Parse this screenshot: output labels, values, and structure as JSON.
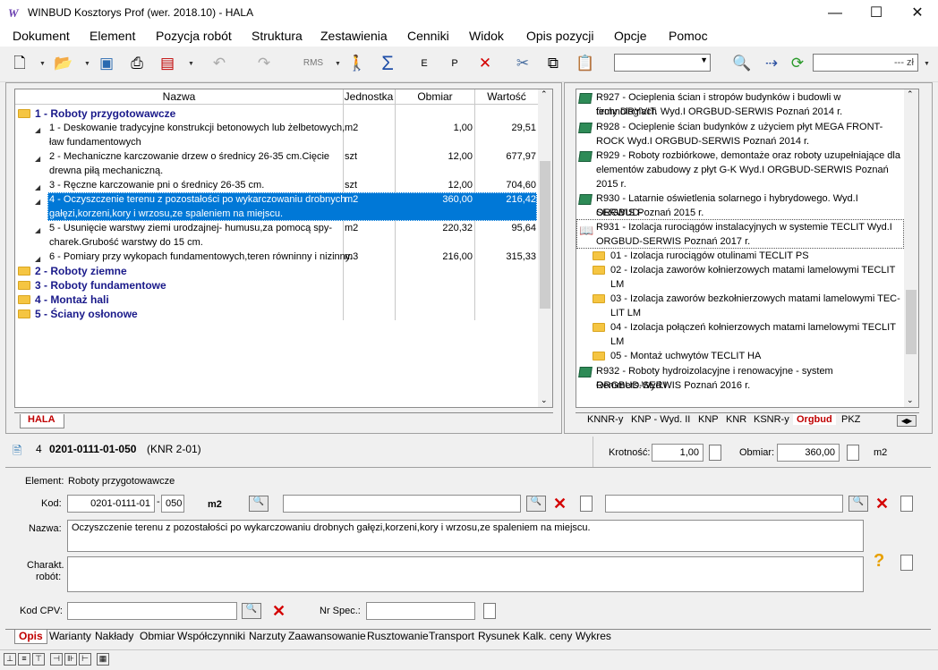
{
  "window": {
    "title": "WINBUD Kosztorys Prof (wer. 2018.10) - HALA",
    "minimize": "—",
    "maximize": "☐",
    "close": "✕"
  },
  "menu": [
    "Dokument",
    "Element",
    "Pozycja robót",
    "Struktura",
    "Zestawienia",
    "Cenniki",
    "Widok",
    "Opis pozycji",
    "Opcje",
    "Pomoc"
  ],
  "toolbar": {
    "currency_suffix": "--- zł"
  },
  "tree": {
    "columns": [
      "Nazwa",
      "Jednostka",
      "Obmiar",
      "Wartość"
    ],
    "element1": "1 - Roboty przygotowawcze",
    "rows": [
      {
        "name1": "1 - Deskowanie tradycyjne konstrukcji betonowych lub żelbetowych,",
        "name2": "ław fundamentowych",
        "unit": "m2",
        "qty": "1,00",
        "value": "29,51"
      },
      {
        "name1": "2 - Mechaniczne karczowanie drzew o średnicy 26-35 cm.Cięcie",
        "name2": "drewna piłą mechaniczną.",
        "unit": "szt",
        "qty": "12,00",
        "value": "677,97"
      },
      {
        "name1": "3 - Ręczne karczowanie pni o średnicy 26-35 cm.",
        "name2": "",
        "unit": "szt",
        "qty": "12,00",
        "value": "704,60"
      },
      {
        "name1": "4 - Oczyszczenie terenu z pozostałości po wykarczowaniu drobnych",
        "name2": "gałęzi,korzeni,kory i wrzosu,ze spaleniem na miejscu.",
        "unit": "m2",
        "qty": "360,00",
        "value": "216,42"
      },
      {
        "name1": "5 - Usunięcie warstwy ziemi urodzajnej- humusu,za pomocą spy-",
        "name2": "charek.Grubość warstwy do 15 cm.",
        "unit": "m2",
        "qty": "220,32",
        "value": "95,64"
      },
      {
        "name1": "6 - Pomiary przy wykopach fundamentowych,teren równinny i nizinny.",
        "name2": "",
        "unit": "m3",
        "qty": "216,00",
        "value": "315,33"
      }
    ],
    "elements": [
      "2 - Roboty ziemne",
      "3 - Roboty fundamentowe",
      "4 - Montaż hali",
      "5 - Ściany osłonowe"
    ],
    "sheet_tab": "HALA"
  },
  "catalog": {
    "items": [
      {
        "l1": "R927 - Ocieplenia ścian i stropów budynków i budowli w technologiach",
        "l2": "firmy DRYVIT. Wyd.I ORGBUD-SERWIS Poznań 2014 r."
      },
      {
        "l1": "R928 - Ocieplenie ścian budynków z użyciem płyt MEGA FRONT-",
        "l2": "ROCK Wyd.I ORGBUD-SERWIS Poznań 2014 r."
      },
      {
        "l1": "R929 - Roboty rozbiórkowe, demontaże oraz roboty uzupełniające dla",
        "l2": "elementów zabudowy z płyt G-K Wyd.I ORGBUD-SERWIS Poznań",
        "l3": "2015 r."
      },
      {
        "l1": "R930 - Latarnie oświetlenia solarnego i hybrydowego. Wyd.I ORGBUD-",
        "l2": "SERWIS Poznań 2015 r."
      },
      {
        "l1": "R931 - Izolacja rurociągów instalacyjnych w systemie TECLIT Wyd.I",
        "l2": "ORGBUD-SERWIS Poznań 2017 r."
      }
    ],
    "subitems": [
      {
        "l1": "01 - Izolacja rurociągów otulinami TECLIT PS",
        "l2": ""
      },
      {
        "l1": "02 - Izolacja zaworów kołnierzowych matami lamelowymi TECLIT",
        "l2": "LM"
      },
      {
        "l1": "03 - Izolacja zaworów bezkołnierzowych matami lamelowymi TEC-",
        "l2": "LIT LM"
      },
      {
        "l1": "04 - Izolacja połączeń kołnierzowych matami lamelowymi TECLIT",
        "l2": "LM"
      },
      {
        "l1": "05 - Montaż uchwytów TECLIT HA",
        "l2": ""
      }
    ],
    "last": {
      "l1": "R932 - Roboty hydroizolacyjne i renowacyjne - system Remmers.Wyd.I",
      "l2": "ORGBUD-SERWIS Poznań 2016 r."
    },
    "tabs": [
      "KNNR-y",
      "KNP - Wyd. II",
      "KNP",
      "KNR",
      "KSNR-y",
      "Orgbud",
      "PKZ"
    ]
  },
  "position": {
    "number": "4",
    "code": "0201-0111-01-050",
    "catalog": "(KNR 2-01)",
    "krotnosc_label": "Krotność:",
    "krotnosc": "1,00",
    "obmiar_label": "Obmiar:",
    "obmiar": "360,00",
    "unit": "m2"
  },
  "form": {
    "element_label": "Element:",
    "element": "Roboty przygotowawcze",
    "kod_label": "Kod:",
    "kod1": "0201-0111-01",
    "kod2": "050",
    "unit": "m2",
    "nazwa_label": "Nazwa:",
    "nazwa": "Oczyszczenie terenu z pozostałości po wykarczowaniu drobnych gałęzi,korzeni,kory i wrzosu,ze spaleniem na miejscu.",
    "charakt_label1": "Charakt.",
    "charakt_label2": "robót:",
    "cpv_label": "Kod CPV:",
    "nrspec_label": "Nr Spec.:"
  },
  "bottom_tabs": [
    "Opis",
    "Warianty",
    "Nakłady",
    "Obmiar",
    "Współczynniki",
    "Narzuty",
    "Zaawansowanie",
    "Rusztowanie",
    "Transport",
    "Rysunek",
    "Kalk. ceny",
    "Wykres"
  ]
}
